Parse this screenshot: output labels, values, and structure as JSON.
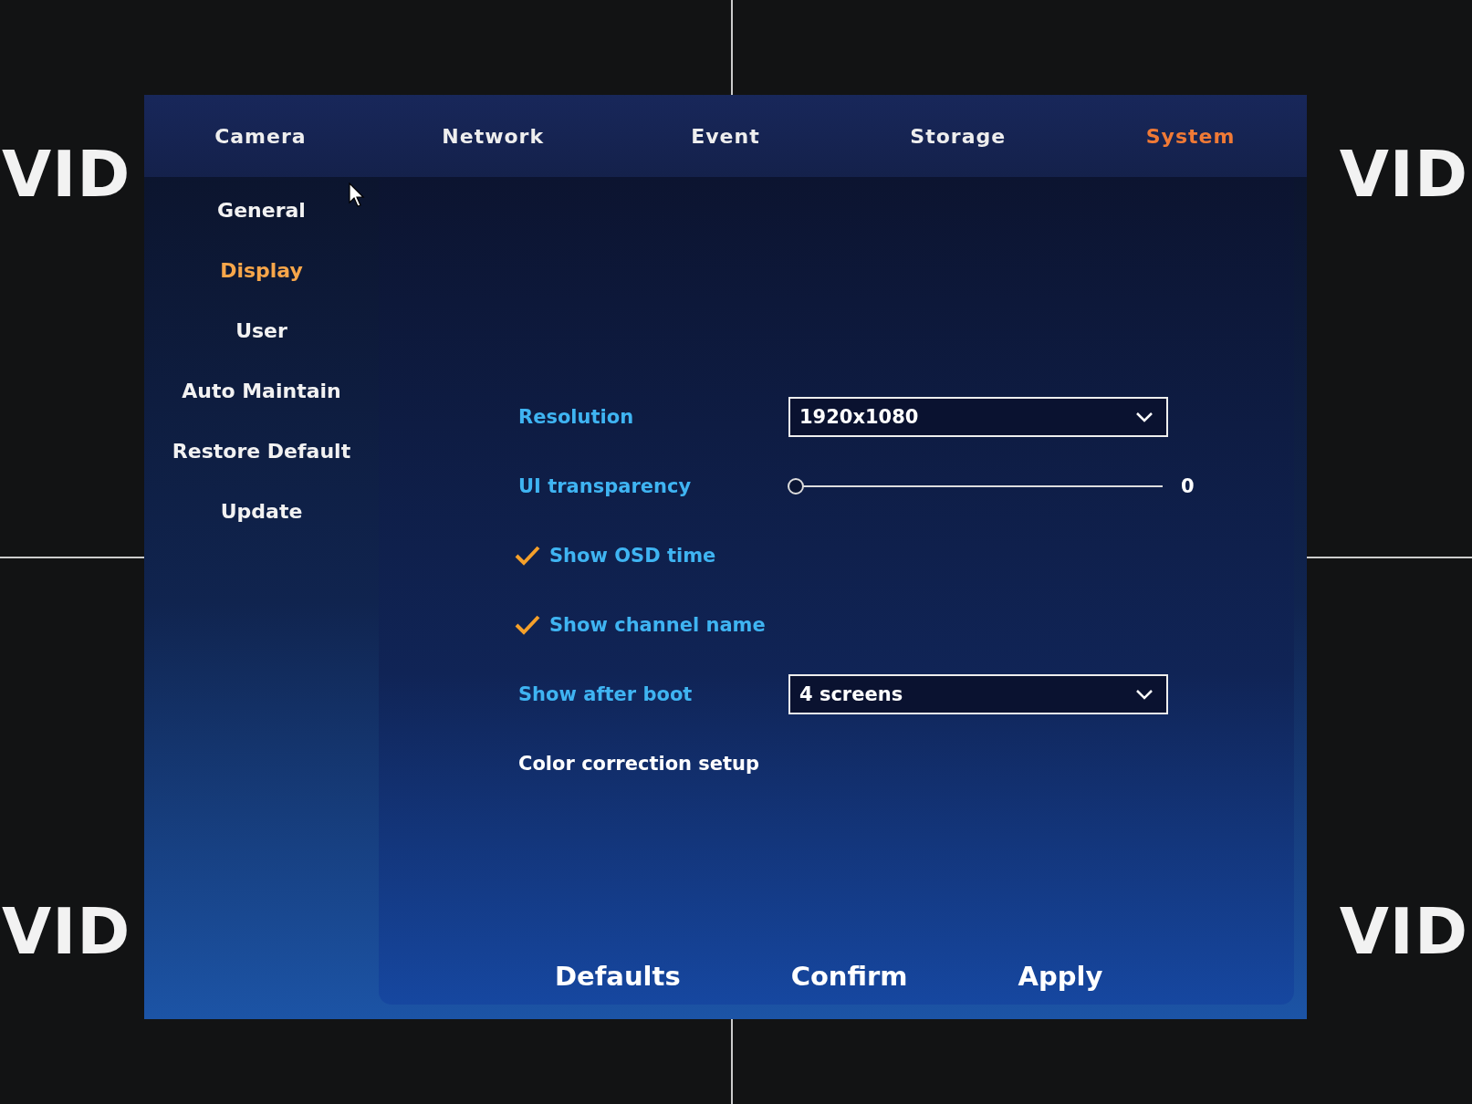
{
  "background_labels": [
    "VID",
    "VID",
    "VID",
    "VID"
  ],
  "tabs": [
    {
      "label": "Camera",
      "selected": false
    },
    {
      "label": "Network",
      "selected": false
    },
    {
      "label": "Event",
      "selected": false
    },
    {
      "label": "Storage",
      "selected": false
    },
    {
      "label": "System",
      "selected": true
    }
  ],
  "sidebar": {
    "items": [
      {
        "label": "General",
        "selected": false
      },
      {
        "label": "Display",
        "selected": true
      },
      {
        "label": "User",
        "selected": false
      },
      {
        "label": "Auto Maintain",
        "selected": false
      },
      {
        "label": "Restore Default",
        "selected": false
      },
      {
        "label": "Update",
        "selected": false
      }
    ]
  },
  "settings": [
    {
      "kind": "dropdown",
      "label": "Resolution",
      "value": "1920x1080"
    },
    {
      "kind": "slider",
      "label": "UI transparency",
      "level": 0,
      "reading": "0"
    },
    {
      "kind": "checkbox",
      "label": "Show OSD time",
      "checked": true
    },
    {
      "kind": "checkbox",
      "label": "Show channel name",
      "checked": true
    },
    {
      "kind": "dropdown",
      "label": "Show after boot",
      "value": "4 screens"
    },
    {
      "kind": "link",
      "label": "Color correction setup"
    }
  ],
  "buttons": [
    "Defaults",
    "Confirm",
    "Apply"
  ]
}
